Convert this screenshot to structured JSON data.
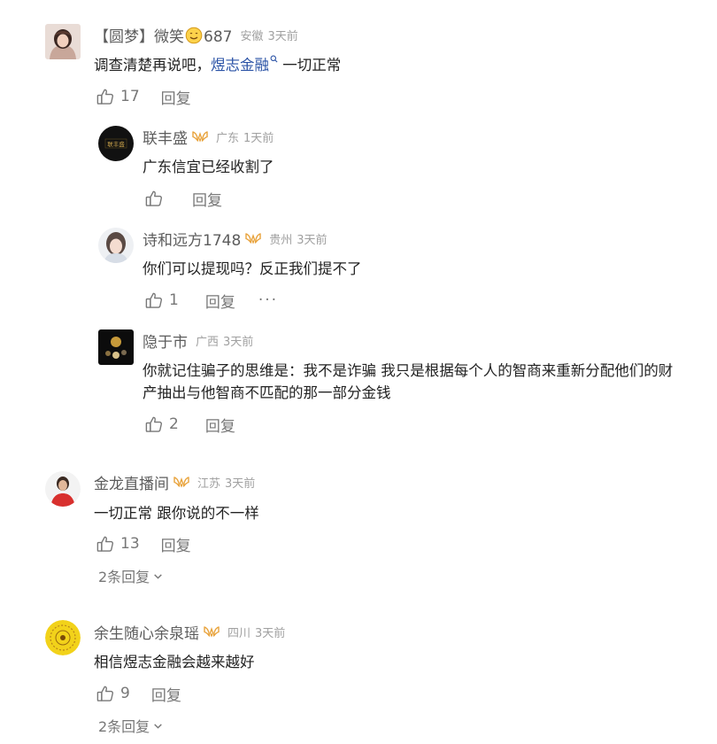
{
  "colors": {
    "link": "#2b53a6",
    "badge_gold": "#e8a23a",
    "meta_gray": "#a0a0a0",
    "action_gray": "#777777"
  },
  "comments": [
    {
      "name": "【圆梦】微笑",
      "name_emoji_icon": "smile-emoji-icon",
      "name_suffix": "687",
      "location": "安徽",
      "time": "3天前",
      "text_before_link": "调查清楚再说吧，",
      "link_text": "煜志金融",
      "text_after_link": " 一切正常",
      "likes": "17",
      "reply_label": "回复",
      "replies": [
        {
          "name": "联丰盛",
          "badge_icon": "creator-badge-icon",
          "location": "广东",
          "time": "1天前",
          "text": "广东信宜已经收割了",
          "likes": "",
          "reply_label": "回复"
        },
        {
          "name": "诗和远方1748",
          "badge_icon": "creator-badge-icon",
          "location": "贵州",
          "time": "3天前",
          "text": "你们可以提现吗？反正我们提不了",
          "likes": "1",
          "reply_label": "回复",
          "more_label": "···"
        },
        {
          "name": "隐于市",
          "location": "广西",
          "time": "3天前",
          "text_line1": "你就记住骗子的思维是：我不是诈骗 我只是根据每个人的智商来重新分配他们的财",
          "text_line2": "产抽出与他智商不匹配的那一部分金钱",
          "likes": "2",
          "reply_label": "回复"
        }
      ]
    },
    {
      "name": "金龙直播间",
      "badge_icon": "creator-badge-icon",
      "location": "江苏",
      "time": "3天前",
      "text": "一切正常 跟你说的不一样",
      "likes": "13",
      "reply_label": "回复",
      "expand_label": "2条回复"
    },
    {
      "name": "余生随心余泉瑶",
      "badge_icon": "creator-badge-icon",
      "location": "四川",
      "time": "3天前",
      "text": "相信煜志金融会越来越好",
      "likes": "9",
      "reply_label": "回复",
      "expand_label": "2条回复"
    }
  ]
}
